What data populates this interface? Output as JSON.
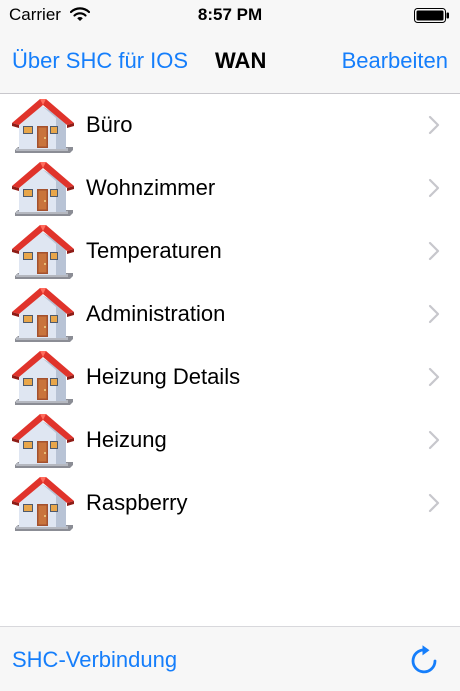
{
  "status_bar": {
    "carrier": "Carrier",
    "time": "8:57 PM"
  },
  "nav": {
    "back_label": "Über SHC für IOS",
    "title": "WAN",
    "edit_label": "Bearbeiten"
  },
  "items": [
    {
      "label": "Büro"
    },
    {
      "label": "Wohnzimmer"
    },
    {
      "label": "Temperaturen"
    },
    {
      "label": "Administration"
    },
    {
      "label": "Heizung Details"
    },
    {
      "label": "Heizung"
    },
    {
      "label": "Raspberry"
    }
  ],
  "toolbar": {
    "connection_label": "SHC-Verbindung"
  },
  "icons": {
    "row_icon": "house-icon",
    "row_accessory": "chevron-right-icon",
    "toolbar_action": "refresh-icon"
  },
  "colors": {
    "accent": "#157efb",
    "roof": "#e0332b",
    "bar_background": "#f7f7f7"
  }
}
